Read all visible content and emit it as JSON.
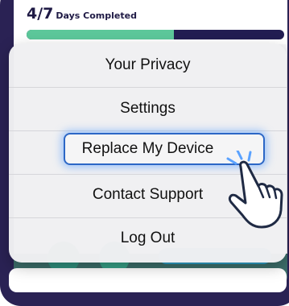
{
  "progress": {
    "count": "4/7",
    "label": "Days Completed",
    "fraction": 0.571
  },
  "menu": {
    "items": [
      {
        "label": "Your Privacy"
      },
      {
        "label": "Settings"
      },
      {
        "label": "Replace My Device"
      },
      {
        "label": "Contact Support"
      },
      {
        "label": "Log Out"
      }
    ],
    "highlighted_item": "Replace My Device"
  },
  "colors": {
    "frame": "#2a2254",
    "progress_fill": "#5cc79a",
    "progress_track": "#221d52",
    "highlight": "#2c67c6"
  },
  "icons": [
    "pointing-hand-icon"
  ]
}
